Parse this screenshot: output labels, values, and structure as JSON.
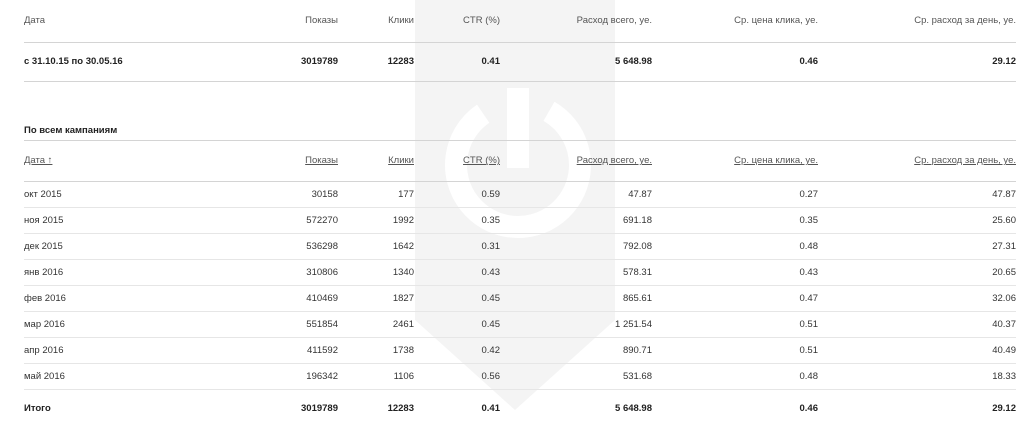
{
  "headers": {
    "date": "Дата",
    "date_sorted": "Дата ↑",
    "impressions": "Показы",
    "clicks": "Клики",
    "ctr": "CTR (%)",
    "spend": "Расход всего, уе.",
    "cpc": "Ср. цена клика, уе.",
    "daily": "Ср. расход за день, уе."
  },
  "summary": {
    "period": "с 31.10.15 по 30.05.16",
    "impressions": "3019789",
    "clicks": "12283",
    "ctr": "0.41",
    "spend": "5 648.98",
    "cpc": "0.46",
    "daily": "29.12"
  },
  "section_title": "По всем кампаниям",
  "rows": [
    {
      "date": "окт 2015",
      "impressions": "30158",
      "clicks": "177",
      "ctr": "0.59",
      "spend": "47.87",
      "cpc": "0.27",
      "daily": "47.87"
    },
    {
      "date": "ноя 2015",
      "impressions": "572270",
      "clicks": "1992",
      "ctr": "0.35",
      "spend": "691.18",
      "cpc": "0.35",
      "daily": "25.60"
    },
    {
      "date": "дек 2015",
      "impressions": "536298",
      "clicks": "1642",
      "ctr": "0.31",
      "spend": "792.08",
      "cpc": "0.48",
      "daily": "27.31"
    },
    {
      "date": "янв 2016",
      "impressions": "310806",
      "clicks": "1340",
      "ctr": "0.43",
      "spend": "578.31",
      "cpc": "0.43",
      "daily": "20.65"
    },
    {
      "date": "фев 2016",
      "impressions": "410469",
      "clicks": "1827",
      "ctr": "0.45",
      "spend": "865.61",
      "cpc": "0.47",
      "daily": "32.06"
    },
    {
      "date": "мар 2016",
      "impressions": "551854",
      "clicks": "2461",
      "ctr": "0.45",
      "spend": "1 251.54",
      "cpc": "0.51",
      "daily": "40.37"
    },
    {
      "date": "апр 2016",
      "impressions": "411592",
      "clicks": "1738",
      "ctr": "0.42",
      "spend": "890.71",
      "cpc": "0.51",
      "daily": "40.49"
    },
    {
      "date": "май 2016",
      "impressions": "196342",
      "clicks": "1106",
      "ctr": "0.56",
      "spend": "531.68",
      "cpc": "0.48",
      "daily": "18.33"
    }
  ],
  "total": {
    "label": "Итого",
    "impressions": "3019789",
    "clicks": "12283",
    "ctr": "0.41",
    "spend": "5 648.98",
    "cpc": "0.46",
    "daily": "29.12"
  }
}
